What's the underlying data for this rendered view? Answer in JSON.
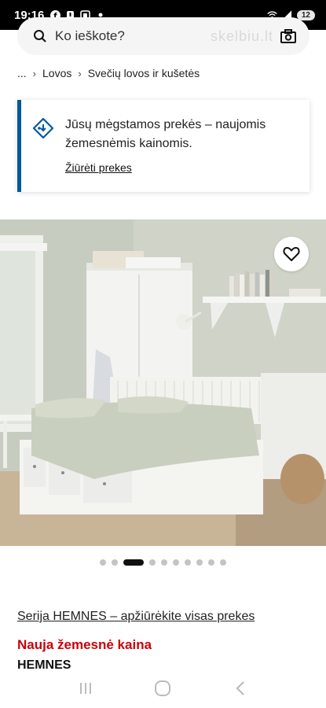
{
  "status": {
    "time": "19:16",
    "battery": "12"
  },
  "search": {
    "placeholder": "Ko ieškote?",
    "watermark": "skelbiu.lt"
  },
  "breadcrumb": {
    "ellipsis": "...",
    "items": [
      "Lovos",
      "Svečių lovos ir kušetės"
    ]
  },
  "notice": {
    "text": "Jūsų mėgstamos prekės – naujomis žemesnėmis kainomis.",
    "link": "Žiūrėti prekes"
  },
  "carousel": {
    "count": 10,
    "active_index": 2
  },
  "series_link": "Serija HEMNES – apžiūrėkite visas prekes",
  "price_label": "Nauja žemesnė kaina",
  "product_name": "HEMNES",
  "colors": {
    "accent_blue": "#0058a3",
    "price_red": "#cc0008"
  }
}
